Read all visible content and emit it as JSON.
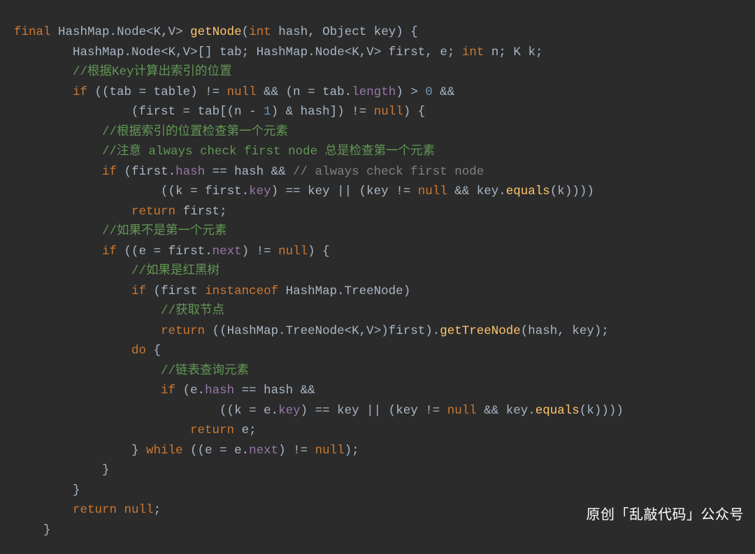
{
  "code": {
    "tokens": [
      [
        [
          "kw",
          "final"
        ],
        [
          "op",
          " "
        ],
        [
          "type",
          "HashMap"
        ],
        [
          "op",
          "."
        ],
        [
          "type",
          "Node"
        ],
        [
          "op",
          "<"
        ],
        [
          "type",
          "K"
        ],
        [
          "op",
          ","
        ],
        [
          "type",
          "V"
        ],
        [
          "op",
          "> "
        ],
        [
          "fn",
          "getNode"
        ],
        [
          "op",
          "("
        ],
        [
          "kw",
          "int"
        ],
        [
          "op",
          " "
        ],
        [
          "id",
          "hash"
        ],
        [
          "op",
          ", "
        ],
        [
          "type",
          "Object"
        ],
        [
          "op",
          " "
        ],
        [
          "id",
          "key"
        ],
        [
          "op",
          ") {"
        ]
      ],
      [
        [
          "op",
          "        "
        ],
        [
          "type",
          "HashMap"
        ],
        [
          "op",
          "."
        ],
        [
          "type",
          "Node"
        ],
        [
          "op",
          "<"
        ],
        [
          "type",
          "K"
        ],
        [
          "op",
          ","
        ],
        [
          "type",
          "V"
        ],
        [
          "op",
          ">[] "
        ],
        [
          "id",
          "tab"
        ],
        [
          "op",
          "; "
        ],
        [
          "type",
          "HashMap"
        ],
        [
          "op",
          "."
        ],
        [
          "type",
          "Node"
        ],
        [
          "op",
          "<"
        ],
        [
          "type",
          "K"
        ],
        [
          "op",
          ","
        ],
        [
          "type",
          "V"
        ],
        [
          "op",
          "> "
        ],
        [
          "id",
          "first"
        ],
        [
          "op",
          ", "
        ],
        [
          "id",
          "e"
        ],
        [
          "op",
          "; "
        ],
        [
          "kw",
          "int"
        ],
        [
          "op",
          " "
        ],
        [
          "id",
          "n"
        ],
        [
          "op",
          "; "
        ],
        [
          "type",
          "K"
        ],
        [
          "op",
          " "
        ],
        [
          "id",
          "k"
        ],
        [
          "op",
          ";"
        ]
      ],
      [
        [
          "op",
          "        "
        ],
        [
          "cmg",
          "//根据Key计算出索引的位置"
        ]
      ],
      [
        [
          "op",
          "        "
        ],
        [
          "kw",
          "if"
        ],
        [
          "op",
          " (("
        ],
        [
          "id",
          "tab"
        ],
        [
          "op",
          " = "
        ],
        [
          "id",
          "table"
        ],
        [
          "op",
          ") != "
        ],
        [
          "kw",
          "null"
        ],
        [
          "op",
          " && ("
        ],
        [
          "id",
          "n"
        ],
        [
          "op",
          " = "
        ],
        [
          "id",
          "tab"
        ],
        [
          "op",
          "."
        ],
        [
          "field",
          "length"
        ],
        [
          "op",
          ") > "
        ],
        [
          "num",
          "0"
        ],
        [
          "op",
          " &&"
        ]
      ],
      [
        [
          "op",
          "                ("
        ],
        [
          "id",
          "first"
        ],
        [
          "op",
          " = "
        ],
        [
          "id",
          "tab"
        ],
        [
          "op",
          "[("
        ],
        [
          "id",
          "n"
        ],
        [
          "op",
          " - "
        ],
        [
          "num",
          "1"
        ],
        [
          "op",
          ") & "
        ],
        [
          "id",
          "hash"
        ],
        [
          "op",
          "]) != "
        ],
        [
          "kw",
          "null"
        ],
        [
          "op",
          ") {"
        ]
      ],
      [
        [
          "op",
          "            "
        ],
        [
          "cmg",
          "//根据索引的位置检查第一个元素"
        ]
      ],
      [
        [
          "op",
          "            "
        ],
        [
          "cmg",
          "//注意 always check first node 总是检查第一个元素"
        ]
      ],
      [
        [
          "op",
          "            "
        ],
        [
          "kw",
          "if"
        ],
        [
          "op",
          " ("
        ],
        [
          "id",
          "first"
        ],
        [
          "op",
          "."
        ],
        [
          "field",
          "hash"
        ],
        [
          "op",
          " == "
        ],
        [
          "id",
          "hash"
        ],
        [
          "op",
          " && "
        ],
        [
          "cm",
          "// always check first node"
        ]
      ],
      [
        [
          "op",
          "                    (("
        ],
        [
          "id",
          "k"
        ],
        [
          "op",
          " = "
        ],
        [
          "id",
          "first"
        ],
        [
          "op",
          "."
        ],
        [
          "field",
          "key"
        ],
        [
          "op",
          ") == "
        ],
        [
          "id",
          "key"
        ],
        [
          "op",
          " || ("
        ],
        [
          "id",
          "key"
        ],
        [
          "op",
          " != "
        ],
        [
          "kw",
          "null"
        ],
        [
          "op",
          " && "
        ],
        [
          "id",
          "key"
        ],
        [
          "op",
          "."
        ],
        [
          "fn",
          "equals"
        ],
        [
          "op",
          "("
        ],
        [
          "id",
          "k"
        ],
        [
          "op",
          "))))"
        ]
      ],
      [
        [
          "op",
          "                "
        ],
        [
          "kw",
          "return"
        ],
        [
          "op",
          " "
        ],
        [
          "id",
          "first"
        ],
        [
          "op",
          ";"
        ]
      ],
      [
        [
          "op",
          "            "
        ],
        [
          "cmg",
          "//如果不是第一个元素"
        ]
      ],
      [
        [
          "op",
          "            "
        ],
        [
          "kw",
          "if"
        ],
        [
          "op",
          " (("
        ],
        [
          "id",
          "e"
        ],
        [
          "op",
          " = "
        ],
        [
          "id",
          "first"
        ],
        [
          "op",
          "."
        ],
        [
          "field",
          "next"
        ],
        [
          "op",
          ") != "
        ],
        [
          "kw",
          "null"
        ],
        [
          "op",
          ") {"
        ]
      ],
      [
        [
          "op",
          "                "
        ],
        [
          "cmg",
          "//如果是红黑树"
        ]
      ],
      [
        [
          "op",
          "                "
        ],
        [
          "kw",
          "if"
        ],
        [
          "op",
          " ("
        ],
        [
          "id",
          "first"
        ],
        [
          "op",
          " "
        ],
        [
          "kw",
          "instanceof"
        ],
        [
          "op",
          " "
        ],
        [
          "type",
          "HashMap"
        ],
        [
          "op",
          "."
        ],
        [
          "type",
          "TreeNode"
        ],
        [
          "op",
          ")"
        ]
      ],
      [
        [
          "op",
          "                    "
        ],
        [
          "cmg",
          "//获取节点"
        ]
      ],
      [
        [
          "op",
          "                    "
        ],
        [
          "kw",
          "return"
        ],
        [
          "op",
          " (("
        ],
        [
          "type",
          "HashMap"
        ],
        [
          "op",
          "."
        ],
        [
          "type",
          "TreeNode"
        ],
        [
          "op",
          "<"
        ],
        [
          "type",
          "K"
        ],
        [
          "op",
          ","
        ],
        [
          "type",
          "V"
        ],
        [
          "op",
          ">)"
        ],
        [
          "id",
          "first"
        ],
        [
          "op",
          ")."
        ],
        [
          "fn",
          "getTreeNode"
        ],
        [
          "op",
          "("
        ],
        [
          "id",
          "hash"
        ],
        [
          "op",
          ", "
        ],
        [
          "id",
          "key"
        ],
        [
          "op",
          ");"
        ]
      ],
      [
        [
          "op",
          "                "
        ],
        [
          "kw",
          "do"
        ],
        [
          "op",
          " {"
        ]
      ],
      [
        [
          "op",
          "                    "
        ],
        [
          "cmg",
          "//链表查询元素"
        ]
      ],
      [
        [
          "op",
          "                    "
        ],
        [
          "kw",
          "if"
        ],
        [
          "op",
          " ("
        ],
        [
          "id",
          "e"
        ],
        [
          "op",
          "."
        ],
        [
          "field",
          "hash"
        ],
        [
          "op",
          " == "
        ],
        [
          "id",
          "hash"
        ],
        [
          "op",
          " &&"
        ]
      ],
      [
        [
          "op",
          "                            (("
        ],
        [
          "id",
          "k"
        ],
        [
          "op",
          " = "
        ],
        [
          "id",
          "e"
        ],
        [
          "op",
          "."
        ],
        [
          "field",
          "key"
        ],
        [
          "op",
          ") == "
        ],
        [
          "id",
          "key"
        ],
        [
          "op",
          " || ("
        ],
        [
          "id",
          "key"
        ],
        [
          "op",
          " != "
        ],
        [
          "kw",
          "null"
        ],
        [
          "op",
          " && "
        ],
        [
          "id",
          "key"
        ],
        [
          "op",
          "."
        ],
        [
          "fn",
          "equals"
        ],
        [
          "op",
          "("
        ],
        [
          "id",
          "k"
        ],
        [
          "op",
          "))))"
        ]
      ],
      [
        [
          "op",
          "                        "
        ],
        [
          "kw",
          "return"
        ],
        [
          "op",
          " "
        ],
        [
          "id",
          "e"
        ],
        [
          "op",
          ";"
        ]
      ],
      [
        [
          "op",
          "                } "
        ],
        [
          "kw",
          "while"
        ],
        [
          "op",
          " (("
        ],
        [
          "id",
          "e"
        ],
        [
          "op",
          " = "
        ],
        [
          "id",
          "e"
        ],
        [
          "op",
          "."
        ],
        [
          "field",
          "next"
        ],
        [
          "op",
          ") != "
        ],
        [
          "kw",
          "null"
        ],
        [
          "op",
          ");"
        ]
      ],
      [
        [
          "op",
          "            }"
        ]
      ],
      [
        [
          "op",
          "        }"
        ]
      ],
      [
        [
          "op",
          "        "
        ],
        [
          "kw",
          "return"
        ],
        [
          "op",
          " "
        ],
        [
          "kw",
          "null"
        ],
        [
          "op",
          ";"
        ]
      ],
      [
        [
          "op",
          "    }"
        ]
      ]
    ]
  },
  "watermark": "原创「乱敲代码」公众号"
}
